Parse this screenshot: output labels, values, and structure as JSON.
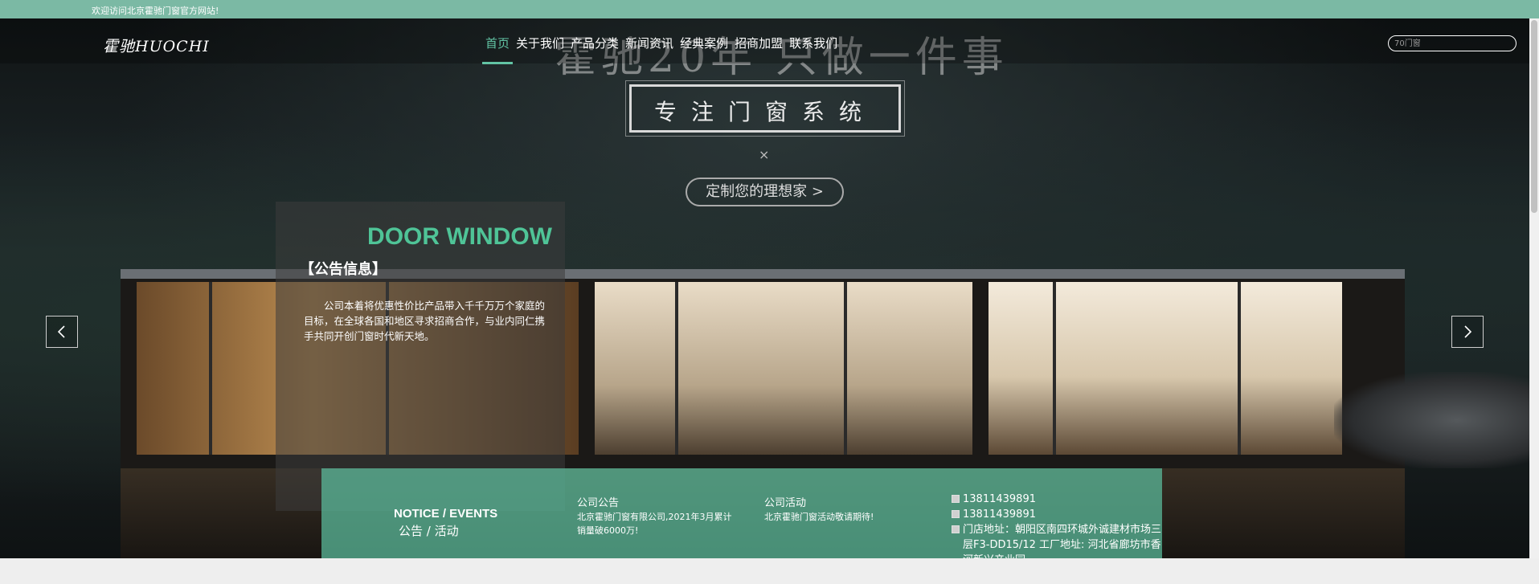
{
  "topbar": {
    "welcome": "欢迎访问北京霍驰门窗官方网站!"
  },
  "header": {
    "logo": "霍驰HUOCHI",
    "nav": [
      "首页",
      "关于我们",
      "产品分类",
      "新闻资讯",
      "经典案例",
      "招商加盟",
      "联系我们"
    ],
    "active_nav": "首页",
    "search_placeholder": "70门窗"
  },
  "banner": {
    "slogan": "霍驰20年 只做一件事",
    "focus": "专注门窗系统",
    "cross": "×",
    "cta": "定制您的理想家 >"
  },
  "notice_panel": {
    "title_en": "DOOR WINDOW",
    "title_cn": "【公告信息】",
    "description": "公司本着将优惠性价比产品带入千千万万个家庭的目标，在全球各国和地区寻求招商合作，与业内同仁携手共同开创门窗时代新天地。"
  },
  "band": {
    "title_en": "NOTICE / EVENTS",
    "title_cn": "公告 / 活动",
    "col_a": {
      "heading": "公司公告",
      "text": "北京霍驰门窗有限公司,2021年3月累计销量破6000万!"
    },
    "col_b": {
      "heading": "公司活动",
      "text": "北京霍驰门窗活动敬请期待!"
    },
    "contact": [
      "13811439891",
      "13811439891",
      "门店地址：朝阳区南四环城外诚建材市场三层F3-DD15/12 工厂地址: 河北省廊坊市香河新兴产业园"
    ]
  },
  "carousel": {
    "slide_count": 6,
    "active_index": 4
  },
  "colors": {
    "accent": "#62c4a4",
    "topbar": "#7bb9a4",
    "band": "#5cbe9e",
    "title_green": "#4fc497"
  },
  "icons": {
    "prev": "chevron-left-icon",
    "next": "chevron-right-icon",
    "contact": "broken-image-icon"
  }
}
